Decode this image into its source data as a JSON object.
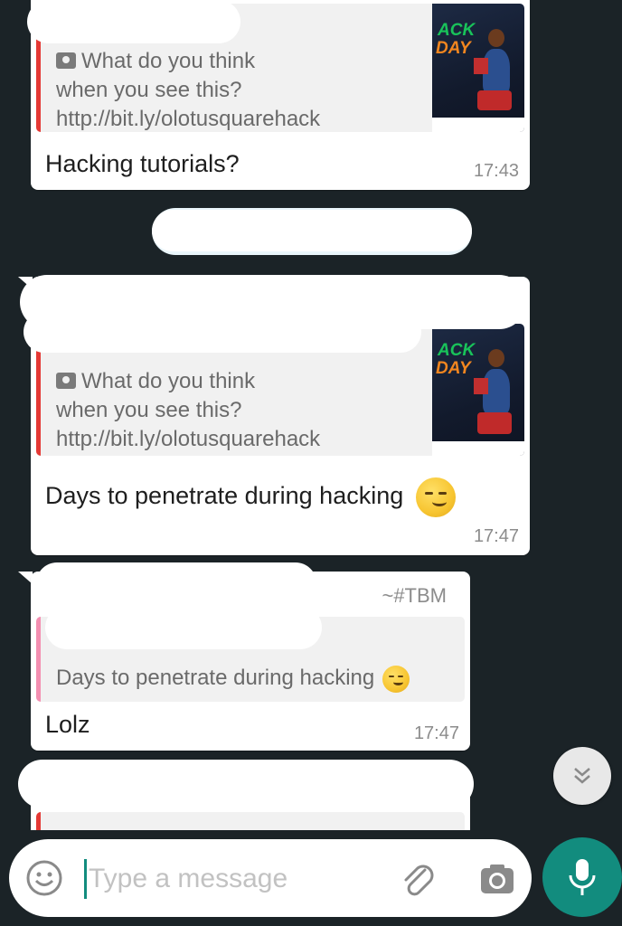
{
  "messages": [
    {
      "quoted": {
        "caption_lines": [
          "What do you think",
          "when you see this?",
          "http://bit.ly/olotusquarehack"
        ]
      },
      "thumb": {
        "line1": "ACK",
        "line2": "DAY"
      },
      "text": "Hacking tutorials?",
      "time": "17:43"
    },
    {
      "quoted": {
        "caption_lines": [
          "What do you think",
          "when you see this?",
          "http://bit.ly/olotusquarehack"
        ]
      },
      "thumb": {
        "line1": "ACK",
        "line2": "DAY"
      },
      "text": "Days to penetrate during hacking",
      "time": "17:47"
    },
    {
      "author_tag": "~#TBM",
      "quoted": {
        "text": "Days to penetrate during hacking"
      },
      "text": "Lolz",
      "time": "17:47"
    }
  ],
  "composer": {
    "placeholder": "Type a message"
  },
  "icons": {
    "emoji": "smiley-icon",
    "attach": "paperclip-icon",
    "camera": "camera-icon",
    "mic": "microphone-icon",
    "scroll": "double-chevron-down-icon"
  },
  "colors": {
    "background": "#1b2327",
    "bubble": "#ffffff",
    "quote_bar_red": "#e53935",
    "quote_bar_pink": "#f48fb1",
    "accent": "#128c7e"
  }
}
